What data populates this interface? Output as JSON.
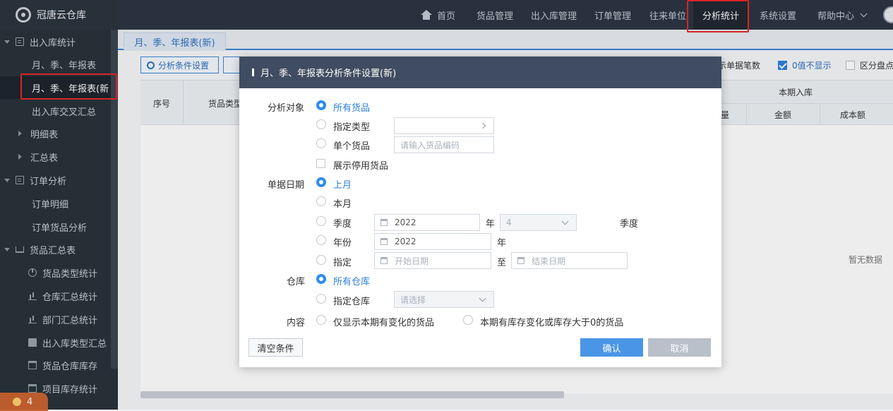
{
  "app": {
    "name": "冠唐云仓库"
  },
  "topnav": {
    "home": "首页",
    "items": [
      "货品管理",
      "出入库管理",
      "订单管理",
      "往来单位",
      "分析统计",
      "系统设置",
      "帮助中心"
    ]
  },
  "sidebar": {
    "g1": "出入库统计",
    "g1_items": [
      "月、季、年报表",
      "月、季、年报表(新",
      "出入库交叉汇总"
    ],
    "mingxi": "明细表",
    "huizong": "汇总表",
    "g2": "订单分析",
    "g2_items": [
      "订单明细",
      "订单货品分析"
    ],
    "g3": "货品汇总表",
    "g3_items": [
      "货品类型统计",
      "仓库汇总统计",
      "部门汇总统计",
      "出入库类型汇总",
      "货品仓库库存",
      "项目库存统计"
    ],
    "badge": "4"
  },
  "tab": {
    "label": "月、季、年报表(新)"
  },
  "toolbar": {
    "settings_btn": "分析条件设置"
  },
  "options": {
    "show_count": "示单据笔数",
    "hide_zero": "0值不显示",
    "distinguish": "区分盘点"
  },
  "grid": {
    "col_seq": "序号",
    "col_type": "货品类型",
    "col_in": "本期入库",
    "col_qty": "量",
    "col_amount": "金额",
    "col_cost": "成本额",
    "empty": "暂无数据"
  },
  "modal": {
    "title": "月、季、年报表分析条件设置(新)",
    "target_label": "分析对象",
    "target_all": "所有货品",
    "target_type": "指定类型",
    "target_single": "单个货品",
    "single_placeholder": "请输入货品编码",
    "show_disabled": "展示停用货品",
    "date_label": "单据日期",
    "last_month": "上月",
    "this_month": "本月",
    "quarter": "季度",
    "quarter_year": "2022",
    "year_unit": "年",
    "quarter_value": "4",
    "quarter_unit": "季度",
    "year": "年份",
    "year_value": "2022",
    "custom": "指定",
    "start_placeholder": "开始日期",
    "to": "至",
    "end_placeholder": "结束日期",
    "wh_label": "仓库",
    "wh_all": "所有仓库",
    "wh_specific": "指定仓库",
    "wh_placeholder": "请选择",
    "content_label": "内容",
    "content_opt1": "仅显示本期有变化的货品",
    "content_opt2": "本期有库存变化或库存大于0的货品",
    "clear": "清空条件",
    "ok": "确认",
    "cancel": "取消"
  },
  "colors": {
    "accent": "#2d8cf0",
    "header_bg": "#3f4c61",
    "highlight": "#e5262a"
  }
}
